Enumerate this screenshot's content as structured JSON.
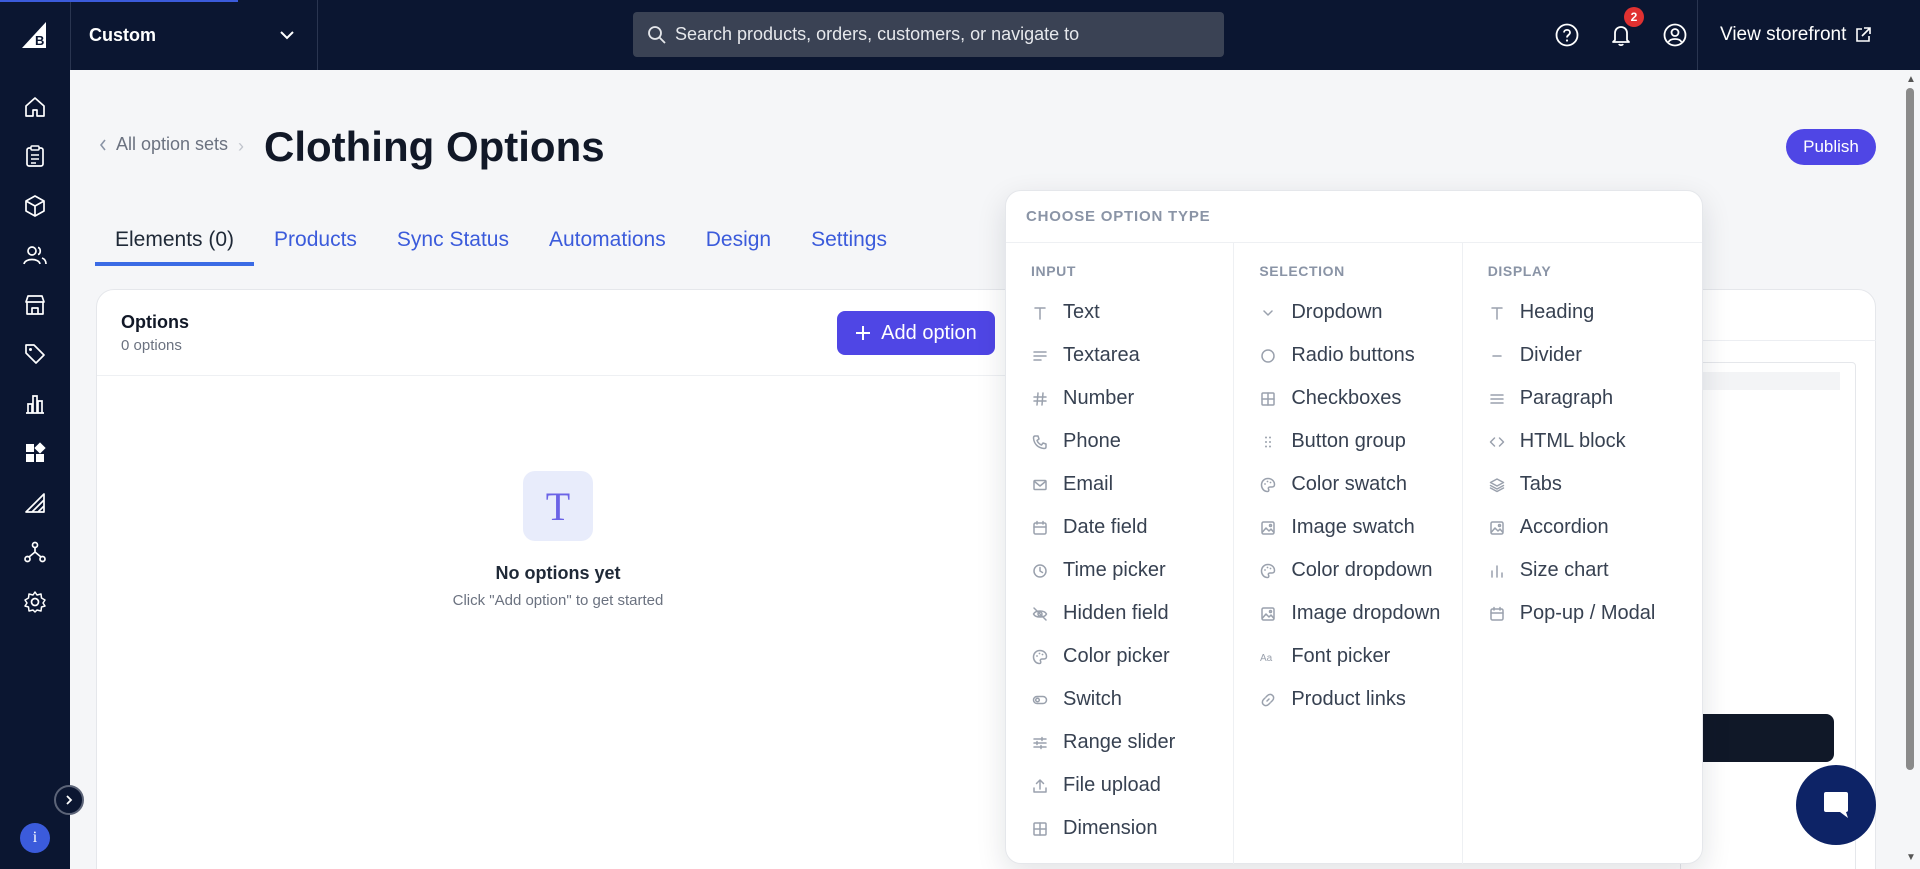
{
  "topbar": {
    "store_name": "Custom",
    "search_placeholder": "Search products, orders, customers, or navigate to",
    "notification_count": "2",
    "view_storefront": "View storefront"
  },
  "sidebar": {
    "items": [
      "home",
      "orders",
      "products",
      "customers",
      "storefront",
      "marketing",
      "analytics",
      "apps",
      "channels",
      "integrations",
      "settings"
    ],
    "active": "apps"
  },
  "page": {
    "breadcrumb": "All option sets",
    "title": "Clothing Options",
    "publish_label": "Publish"
  },
  "tabs": [
    {
      "label": "Elements (0)",
      "active": true
    },
    {
      "label": "Products",
      "active": false
    },
    {
      "label": "Sync Status",
      "active": false
    },
    {
      "label": "Automations",
      "active": false
    },
    {
      "label": "Design",
      "active": false
    },
    {
      "label": "Settings",
      "active": false
    }
  ],
  "options_panel": {
    "title": "Options",
    "count": "0 options",
    "add_label": "Add option",
    "empty_icon": "T",
    "empty_title": "No options yet",
    "empty_sub": "Click \"Add option\" to get started"
  },
  "popover": {
    "title": "CHOOSE OPTION TYPE",
    "columns": [
      {
        "heading": "INPUT",
        "items": [
          {
            "label": "Text",
            "icon": "text-icon"
          },
          {
            "label": "Textarea",
            "icon": "textarea-icon"
          },
          {
            "label": "Number",
            "icon": "hash-icon"
          },
          {
            "label": "Phone",
            "icon": "phone-icon"
          },
          {
            "label": "Email",
            "icon": "mail-icon"
          },
          {
            "label": "Date field",
            "icon": "calendar-icon"
          },
          {
            "label": "Time picker",
            "icon": "clock-icon"
          },
          {
            "label": "Hidden field",
            "icon": "eye-off-icon"
          },
          {
            "label": "Color picker",
            "icon": "palette-icon"
          },
          {
            "label": "Switch",
            "icon": "toggle-icon"
          },
          {
            "label": "Range slider",
            "icon": "sliders-icon"
          },
          {
            "label": "File upload",
            "icon": "upload-icon"
          },
          {
            "label": "Dimension",
            "icon": "grid-icon"
          }
        ]
      },
      {
        "heading": "SELECTION",
        "items": [
          {
            "label": "Dropdown",
            "icon": "chevron-down-icon"
          },
          {
            "label": "Radio buttons",
            "icon": "circle-icon"
          },
          {
            "label": "Checkboxes",
            "icon": "grid-icon"
          },
          {
            "label": "Button group",
            "icon": "grip-icon"
          },
          {
            "label": "Color swatch",
            "icon": "palette-icon"
          },
          {
            "label": "Image swatch",
            "icon": "image-icon"
          },
          {
            "label": "Color dropdown",
            "icon": "palette-icon"
          },
          {
            "label": "Image dropdown",
            "icon": "image-icon"
          },
          {
            "label": "Font picker",
            "icon": "font-icon"
          },
          {
            "label": "Product links",
            "icon": "link-icon"
          }
        ]
      },
      {
        "heading": "DISPLAY",
        "items": [
          {
            "label": "Heading",
            "icon": "text-icon"
          },
          {
            "label": "Divider",
            "icon": "minus-icon"
          },
          {
            "label": "Paragraph",
            "icon": "paragraph-icon"
          },
          {
            "label": "HTML block",
            "icon": "code-icon"
          },
          {
            "label": "Tabs",
            "icon": "layers-icon"
          },
          {
            "label": "Accordion",
            "icon": "image-icon"
          },
          {
            "label": "Size chart",
            "icon": "bar-chart-icon"
          },
          {
            "label": "Pop-up / Modal",
            "icon": "calendar-icon"
          }
        ]
      }
    ]
  },
  "colors": {
    "topbar": "#0b1631",
    "accent": "#4f46e5",
    "link": "#3b5bdb",
    "badge": "#e03131"
  }
}
